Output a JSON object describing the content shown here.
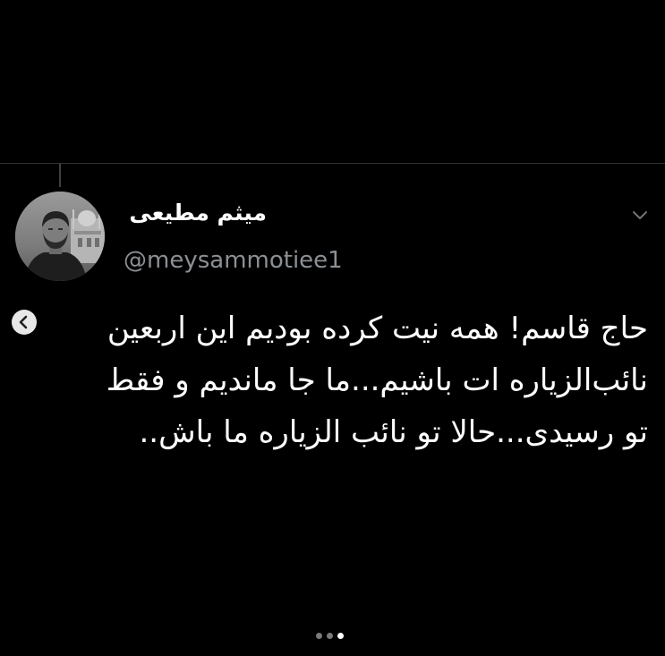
{
  "tweet": {
    "display_name": "میثم مطیعی",
    "handle": "@meysammotiee1",
    "text_lines": [
      "حاج قاسم! همه نیت کرده بودیم این اربعین",
      "نائب‌الزیاره ات باشیم...ما جا ماندیم و فقط",
      "تو رسیدی...حالا تو نائب الزیاره ما باش.."
    ]
  },
  "icons": {
    "avatar": "profile-photo",
    "menu": "chevron-down-icon",
    "carousel_prev": "chevron-left-icon"
  },
  "carousel": {
    "total_slides": 3,
    "active_index": 2
  },
  "colors": {
    "background": "#000000",
    "text_primary": "#ffffff",
    "text_secondary": "#8b9095",
    "divider": "#2f3336",
    "dot_inactive": "#7a7a7a",
    "dot_active": "#ffffff"
  }
}
